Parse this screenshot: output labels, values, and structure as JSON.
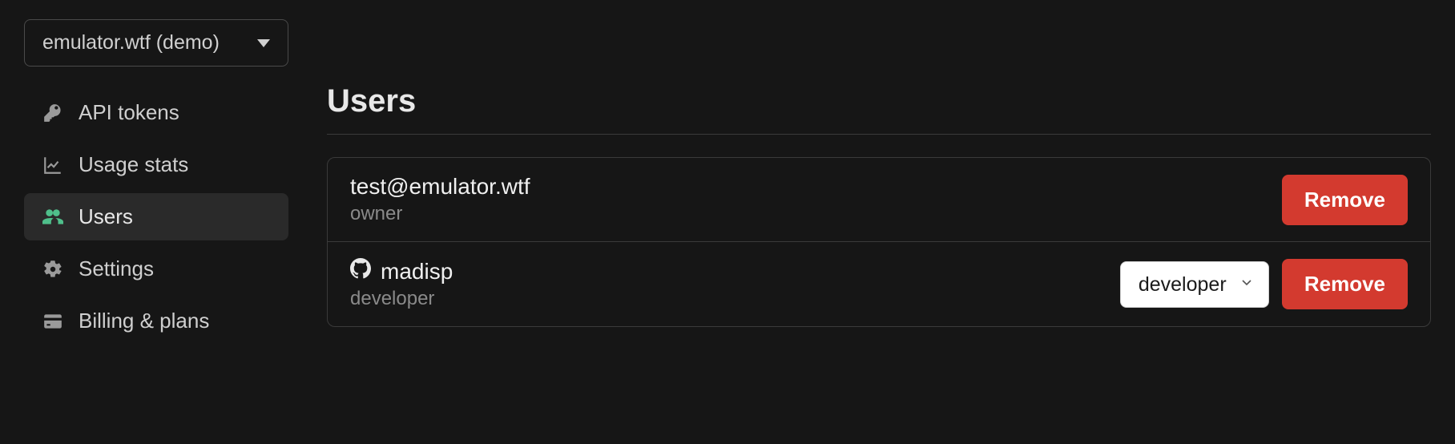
{
  "org_switcher": {
    "label": "emulator.wtf (demo)"
  },
  "sidebar": {
    "items": [
      {
        "label": "API tokens"
      },
      {
        "label": "Usage stats"
      },
      {
        "label": "Users"
      },
      {
        "label": "Settings"
      },
      {
        "label": "Billing & plans"
      }
    ]
  },
  "main": {
    "title": "Users",
    "users": [
      {
        "identity": "test@emulator.wtf",
        "role": "owner",
        "provider": null,
        "role_editable": false,
        "remove_label": "Remove"
      },
      {
        "identity": "madisp",
        "role": "developer",
        "provider": "github",
        "role_editable": true,
        "role_select_value": "developer",
        "remove_label": "Remove"
      }
    ]
  }
}
